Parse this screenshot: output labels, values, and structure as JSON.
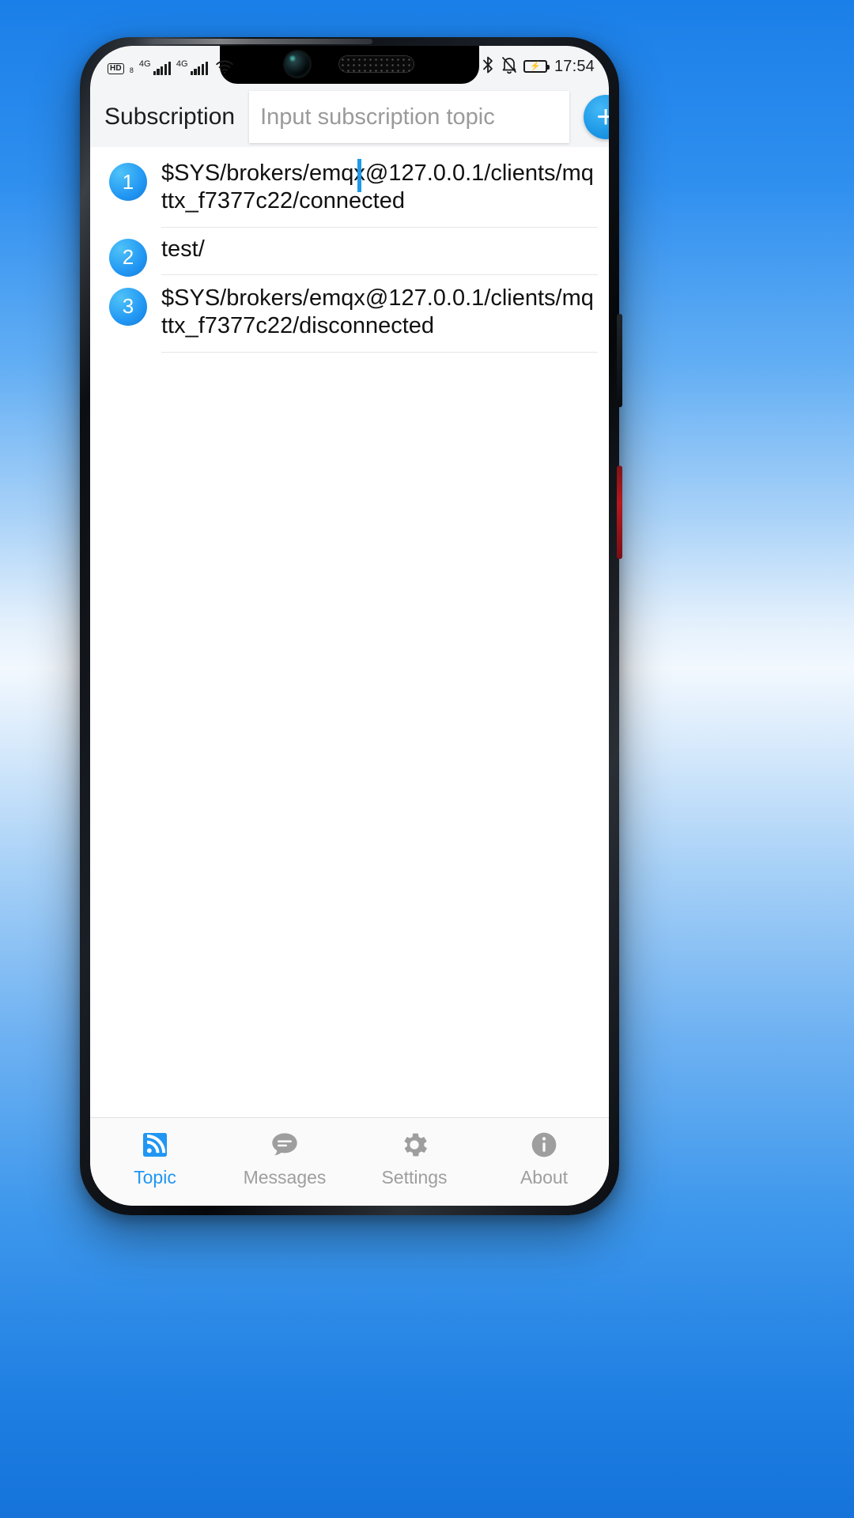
{
  "statusbar": {
    "hd_label": "HD",
    "hd_sub": "8",
    "sim1_gen": "4G",
    "sim2_gen": "4G",
    "signal_icon": "signal-bars-icon",
    "wifi_icon": "wifi-icon",
    "bluetooth_icon": "bluetooth-icon",
    "mute_icon": "bell-muted-icon",
    "battery_icon": "battery-charging-icon",
    "battery_glyph": "⚡",
    "time": "17:54"
  },
  "header": {
    "title": "Subscription",
    "input_value": "",
    "input_placeholder": "Input subscription topic",
    "add_label": "+",
    "add_icon": "plus-icon"
  },
  "subscriptions": [
    {
      "index": "1",
      "topic": "$SYS/brokers/emqx@127.0.0.1/clients/mqttx_f7377c22/connected"
    },
    {
      "index": "2",
      "topic": "test/"
    },
    {
      "index": "3",
      "topic": "$SYS/brokers/emqx@127.0.0.1/clients/mqttx_f7377c22/disconnected"
    }
  ],
  "bottomnav": {
    "items": [
      {
        "label": "Topic",
        "icon": "rss-feed-icon",
        "active": true
      },
      {
        "label": "Messages",
        "icon": "chat-bubble-icon",
        "active": false
      },
      {
        "label": "Settings",
        "icon": "gear-icon",
        "active": false
      },
      {
        "label": "About",
        "icon": "info-circle-icon",
        "active": false
      }
    ]
  },
  "colors": {
    "accent": "#2196f3",
    "accent_light": "#4fc3f7",
    "inactive": "#9e9e9e",
    "header_bg": "#f4f5f7",
    "caret": "#1e9ae8"
  }
}
